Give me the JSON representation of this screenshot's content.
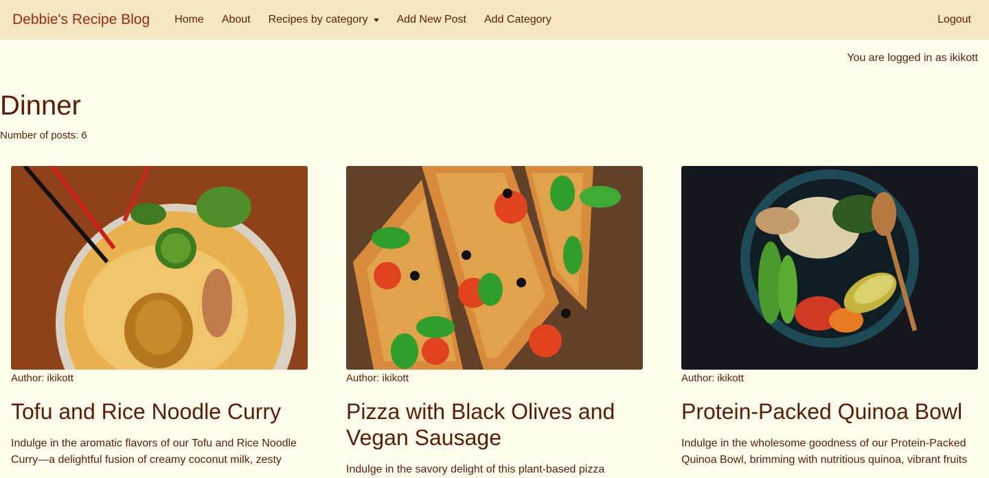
{
  "navbar": {
    "brand": "Debbie's Recipe Blog",
    "links": [
      {
        "label": "Home"
      },
      {
        "label": "About"
      },
      {
        "label": "Recipes by category"
      },
      {
        "label": "Add New Post"
      },
      {
        "label": "Add Category"
      }
    ],
    "logout": "Logout"
  },
  "login_status": "You are logged in as ikikott",
  "category": {
    "title": "Dinner",
    "post_count": "Number of posts: 6"
  },
  "posts": [
    {
      "author": "Author: ikikott",
      "title": "Tofu and Rice Noodle Curry",
      "excerpt": "Indulge in the aromatic flavors of our Tofu and Rice Noodle Curry—a delightful fusion of creamy coconut milk, zesty"
    },
    {
      "author": "Author: ikikott",
      "title": "Pizza with Black Olives and Vegan Sausage",
      "excerpt": "Indulge in the savory delight of this plant-based pizza"
    },
    {
      "author": "Author: ikikott",
      "title": "Protein-Packed Quinoa Bowl",
      "excerpt": "Indulge in the wholesome goodness of our Protein-Packed Quinoa Bowl, brimming with nutritious quinoa, vibrant fruits"
    }
  ],
  "colors": {
    "navbar_bg": "#f6e7c4",
    "page_bg": "#fffeec",
    "text": "#5b1b07",
    "brand": "#9b2a0c"
  }
}
